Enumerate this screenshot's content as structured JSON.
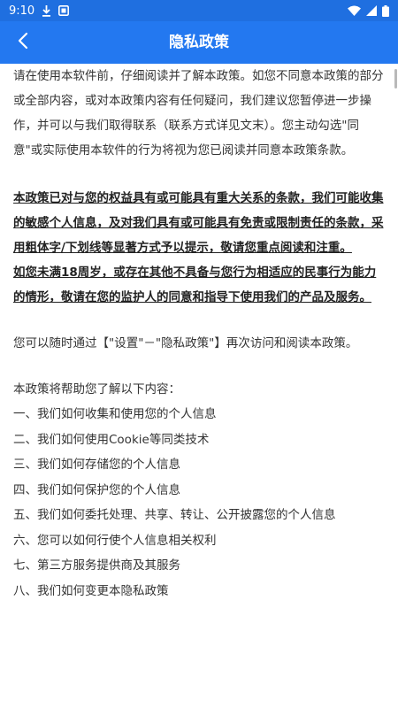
{
  "status_bar": {
    "time": "9:10",
    "left_icons": [
      "download-icon",
      "notification-icon"
    ],
    "right_icons": [
      "wifi-icon",
      "signal-icon",
      "battery-icon"
    ]
  },
  "app_bar": {
    "title": "隐私政策",
    "back_icon": "back-arrow-icon",
    "background": "#2378f0"
  },
  "content": {
    "intro": "请在使用本软件前，仔细阅读并了解本政策。如您不同意本政策的部分或全部内容，或对本政策内容有任何疑问，我们建议您暂停进一步操作，并可以与我们取得联系（联系方式详见文末）。您主动勾选\"同意\"或实际使用本软件的行为将视为您已阅读并同意本政策条款。",
    "notice_1": "本政策已对与您的权益具有或可能具有重大关系的条款，我们可能收集的敏感个人信息，及对我们具有或可能具有免责或限制责任的条款，采用粗体字/下划线等显著方式予以提示，敬请您重点阅读和注重。",
    "notice_2": "如您未满18周岁，或存在其他不具备与您行为相适应的民事行为能力的情形，敬请在您的监护人的同意和指导下使用我们的产品及服务。",
    "revisit": "您可以随时通过【\"设置\"－\"隐私政策\"】再次访问和阅读本政策。",
    "toc_intro": "本政策将帮助您了解以下内容：",
    "toc": [
      "一、我们如何收集和使用您的个人信息",
      "二、我们如何使用Cookie等同类技术",
      "三、我们如何存储您的个人信息",
      "四、我们如何保护您的个人信息",
      "五、我们如何委托处理、共享、转让、公开披露您的个人信息",
      "六、您可以如何行使个人信息相关权利",
      "七、第三方服务提供商及其服务",
      "八、我们如何变更本隐私政策"
    ]
  }
}
